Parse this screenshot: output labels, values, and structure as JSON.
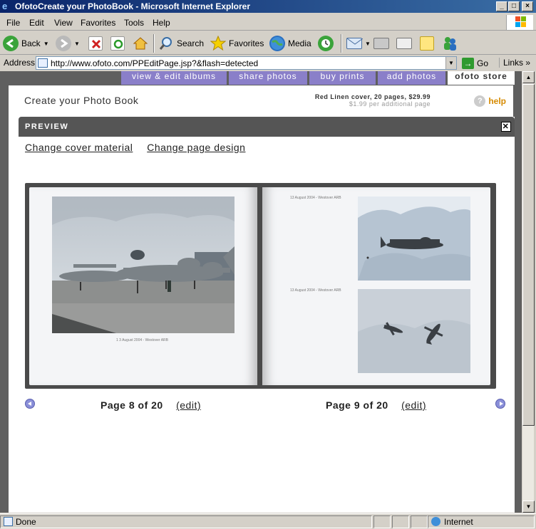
{
  "window": {
    "title": "OfotoCreate your PhotoBook - Microsoft Internet Explorer"
  },
  "menu": [
    "File",
    "Edit",
    "View",
    "Favorites",
    "Tools",
    "Help"
  ],
  "toolbar": {
    "back": "Back",
    "search": "Search",
    "favorites": "Favorites",
    "media": "Media"
  },
  "address": {
    "label": "Address",
    "url": "http://www.ofoto.com/PPEditPage.jsp?&flash=detected",
    "go": "Go",
    "links": "Links"
  },
  "site_tabs": [
    "view & edit albums",
    "share photos",
    "buy prints",
    "add photos",
    "ofoto store"
  ],
  "page": {
    "title": "Create your Photo Book",
    "price_line": "Red Linen cover, 20 pages, $29.99",
    "price_sub": "$1.99 per additional page",
    "help": "help"
  },
  "preview": {
    "header": "PREVIEW",
    "close": "✕",
    "change_cover": "Change cover material",
    "change_design": "Change page design"
  },
  "book": {
    "left_caption": "1 3 August 2004 - Westover ARB",
    "right_caption_1": "13 August 2004 - Westover ARB",
    "right_caption_2": "13 August 2004 - Westover ARB"
  },
  "pager": {
    "left_page": "Page 8 of 20",
    "right_page": "Page 9 of 20",
    "edit": "(edit)"
  },
  "status": {
    "text": "Done",
    "zone": "Internet"
  }
}
